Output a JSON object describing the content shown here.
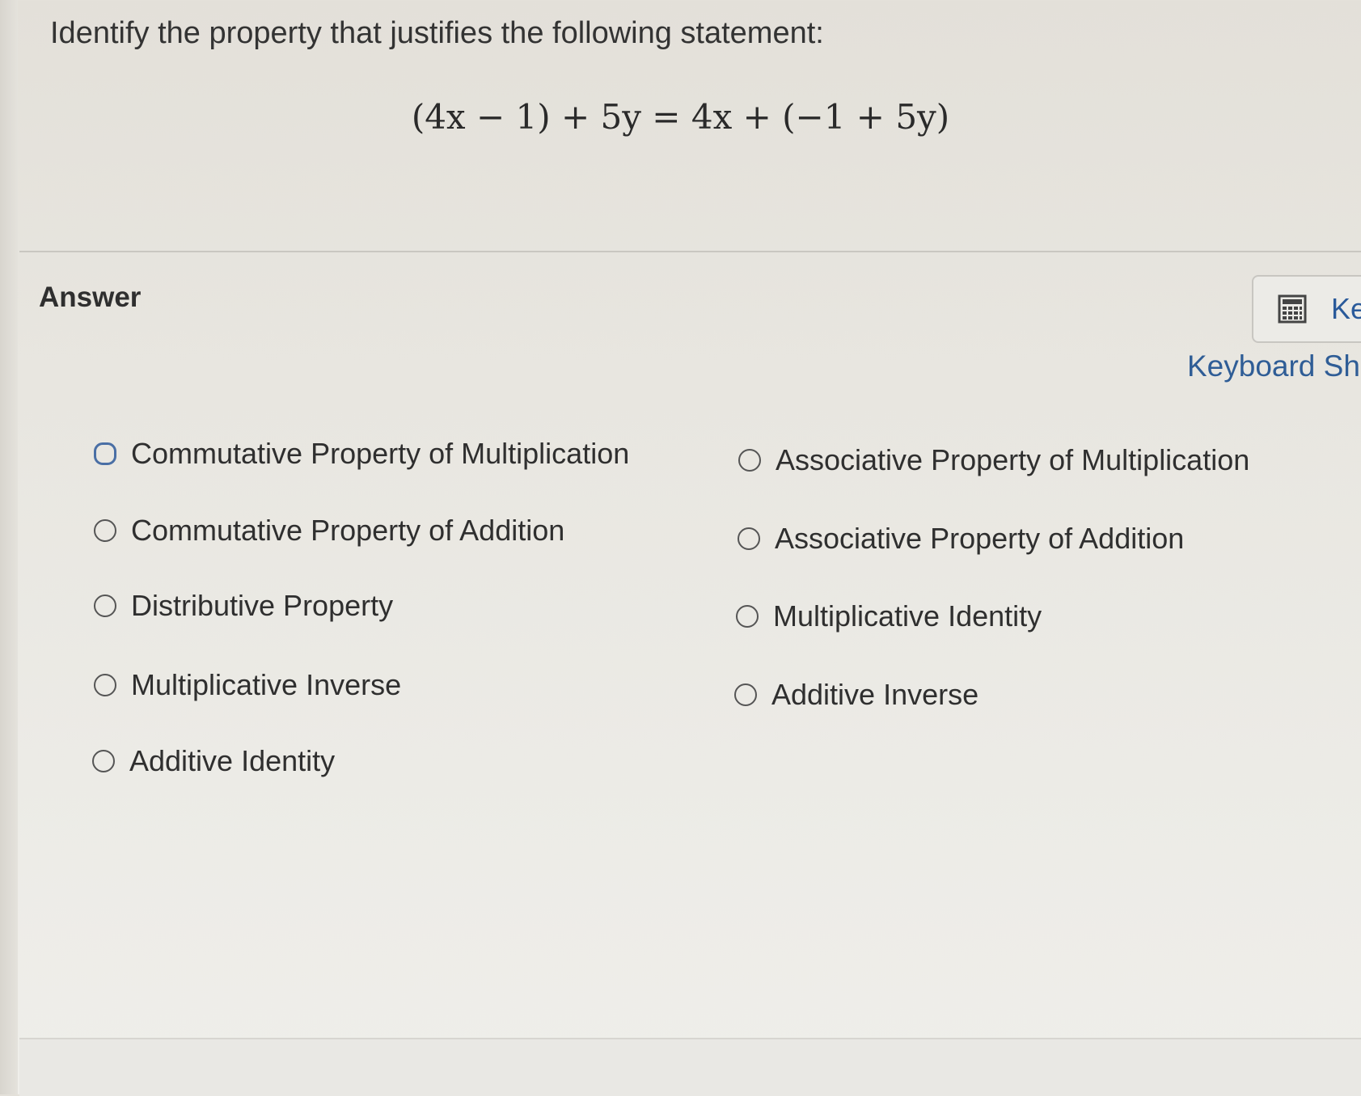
{
  "question": {
    "prompt": "Identify the property that justifies the following statement:",
    "equation": "(4x − 1) + 5y = 4x + (−1 + 5y)"
  },
  "answer": {
    "label": "Answer",
    "keypad_label": "Ke",
    "keyboard_shortcuts": "Keyboard Sh",
    "options": [
      "Commutative Property of Multiplication",
      "Associative Property of Multiplication",
      "Commutative Property of Addition",
      "Associative Property of Addition",
      "Distributive Property",
      "Multiplicative Identity",
      "Multiplicative Inverse",
      "Additive Inverse",
      "Additive Identity"
    ]
  },
  "colors": {
    "link": "#2f5d96",
    "text": "#2f2f2f",
    "focus": "#4a6fa5"
  }
}
